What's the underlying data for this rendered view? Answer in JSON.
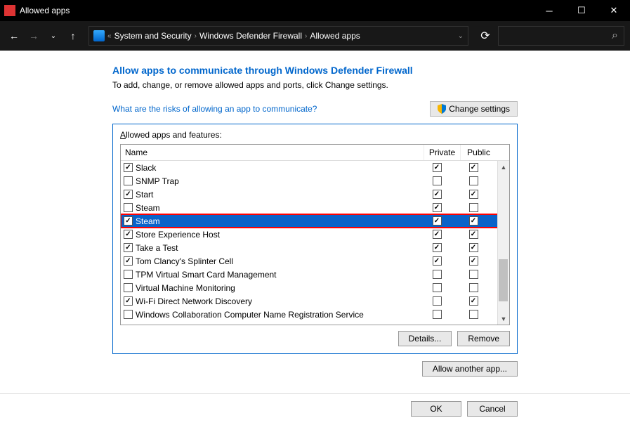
{
  "window": {
    "title": "Allowed apps"
  },
  "breadcrumb": {
    "items": [
      "System and Security",
      "Windows Defender Firewall",
      "Allowed apps"
    ]
  },
  "page": {
    "heading": "Allow apps to communicate through Windows Defender Firewall",
    "subtext": "To add, change, or remove allowed apps and ports, click Change settings.",
    "risk_link": "What are the risks of allowing an app to communicate?",
    "change_settings": "Change settings",
    "group_label": "Allowed apps and features:",
    "cols": {
      "name": "Name",
      "private": "Private",
      "public": "Public"
    },
    "rows": [
      {
        "name": "Slack",
        "enabled": true,
        "private": true,
        "public": true,
        "selected": false
      },
      {
        "name": "SNMP Trap",
        "enabled": false,
        "private": false,
        "public": false,
        "selected": false
      },
      {
        "name": "Start",
        "enabled": true,
        "private": true,
        "public": true,
        "selected": false
      },
      {
        "name": "Steam",
        "enabled": false,
        "private": true,
        "public": false,
        "selected": false
      },
      {
        "name": "Steam",
        "enabled": true,
        "private": true,
        "public": true,
        "selected": true
      },
      {
        "name": "Store Experience Host",
        "enabled": true,
        "private": true,
        "public": true,
        "selected": false
      },
      {
        "name": "Take a Test",
        "enabled": true,
        "private": true,
        "public": true,
        "selected": false
      },
      {
        "name": "Tom Clancy's Splinter Cell",
        "enabled": true,
        "private": true,
        "public": true,
        "selected": false
      },
      {
        "name": "TPM Virtual Smart Card Management",
        "enabled": false,
        "private": false,
        "public": false,
        "selected": false
      },
      {
        "name": "Virtual Machine Monitoring",
        "enabled": false,
        "private": false,
        "public": false,
        "selected": false
      },
      {
        "name": "Wi-Fi Direct Network Discovery",
        "enabled": true,
        "private": false,
        "public": true,
        "selected": false
      },
      {
        "name": "Windows Collaboration Computer Name Registration Service",
        "enabled": false,
        "private": false,
        "public": false,
        "selected": false
      }
    ],
    "details": "Details...",
    "remove": "Remove",
    "allow_another": "Allow another app...",
    "ok": "OK",
    "cancel": "Cancel"
  }
}
